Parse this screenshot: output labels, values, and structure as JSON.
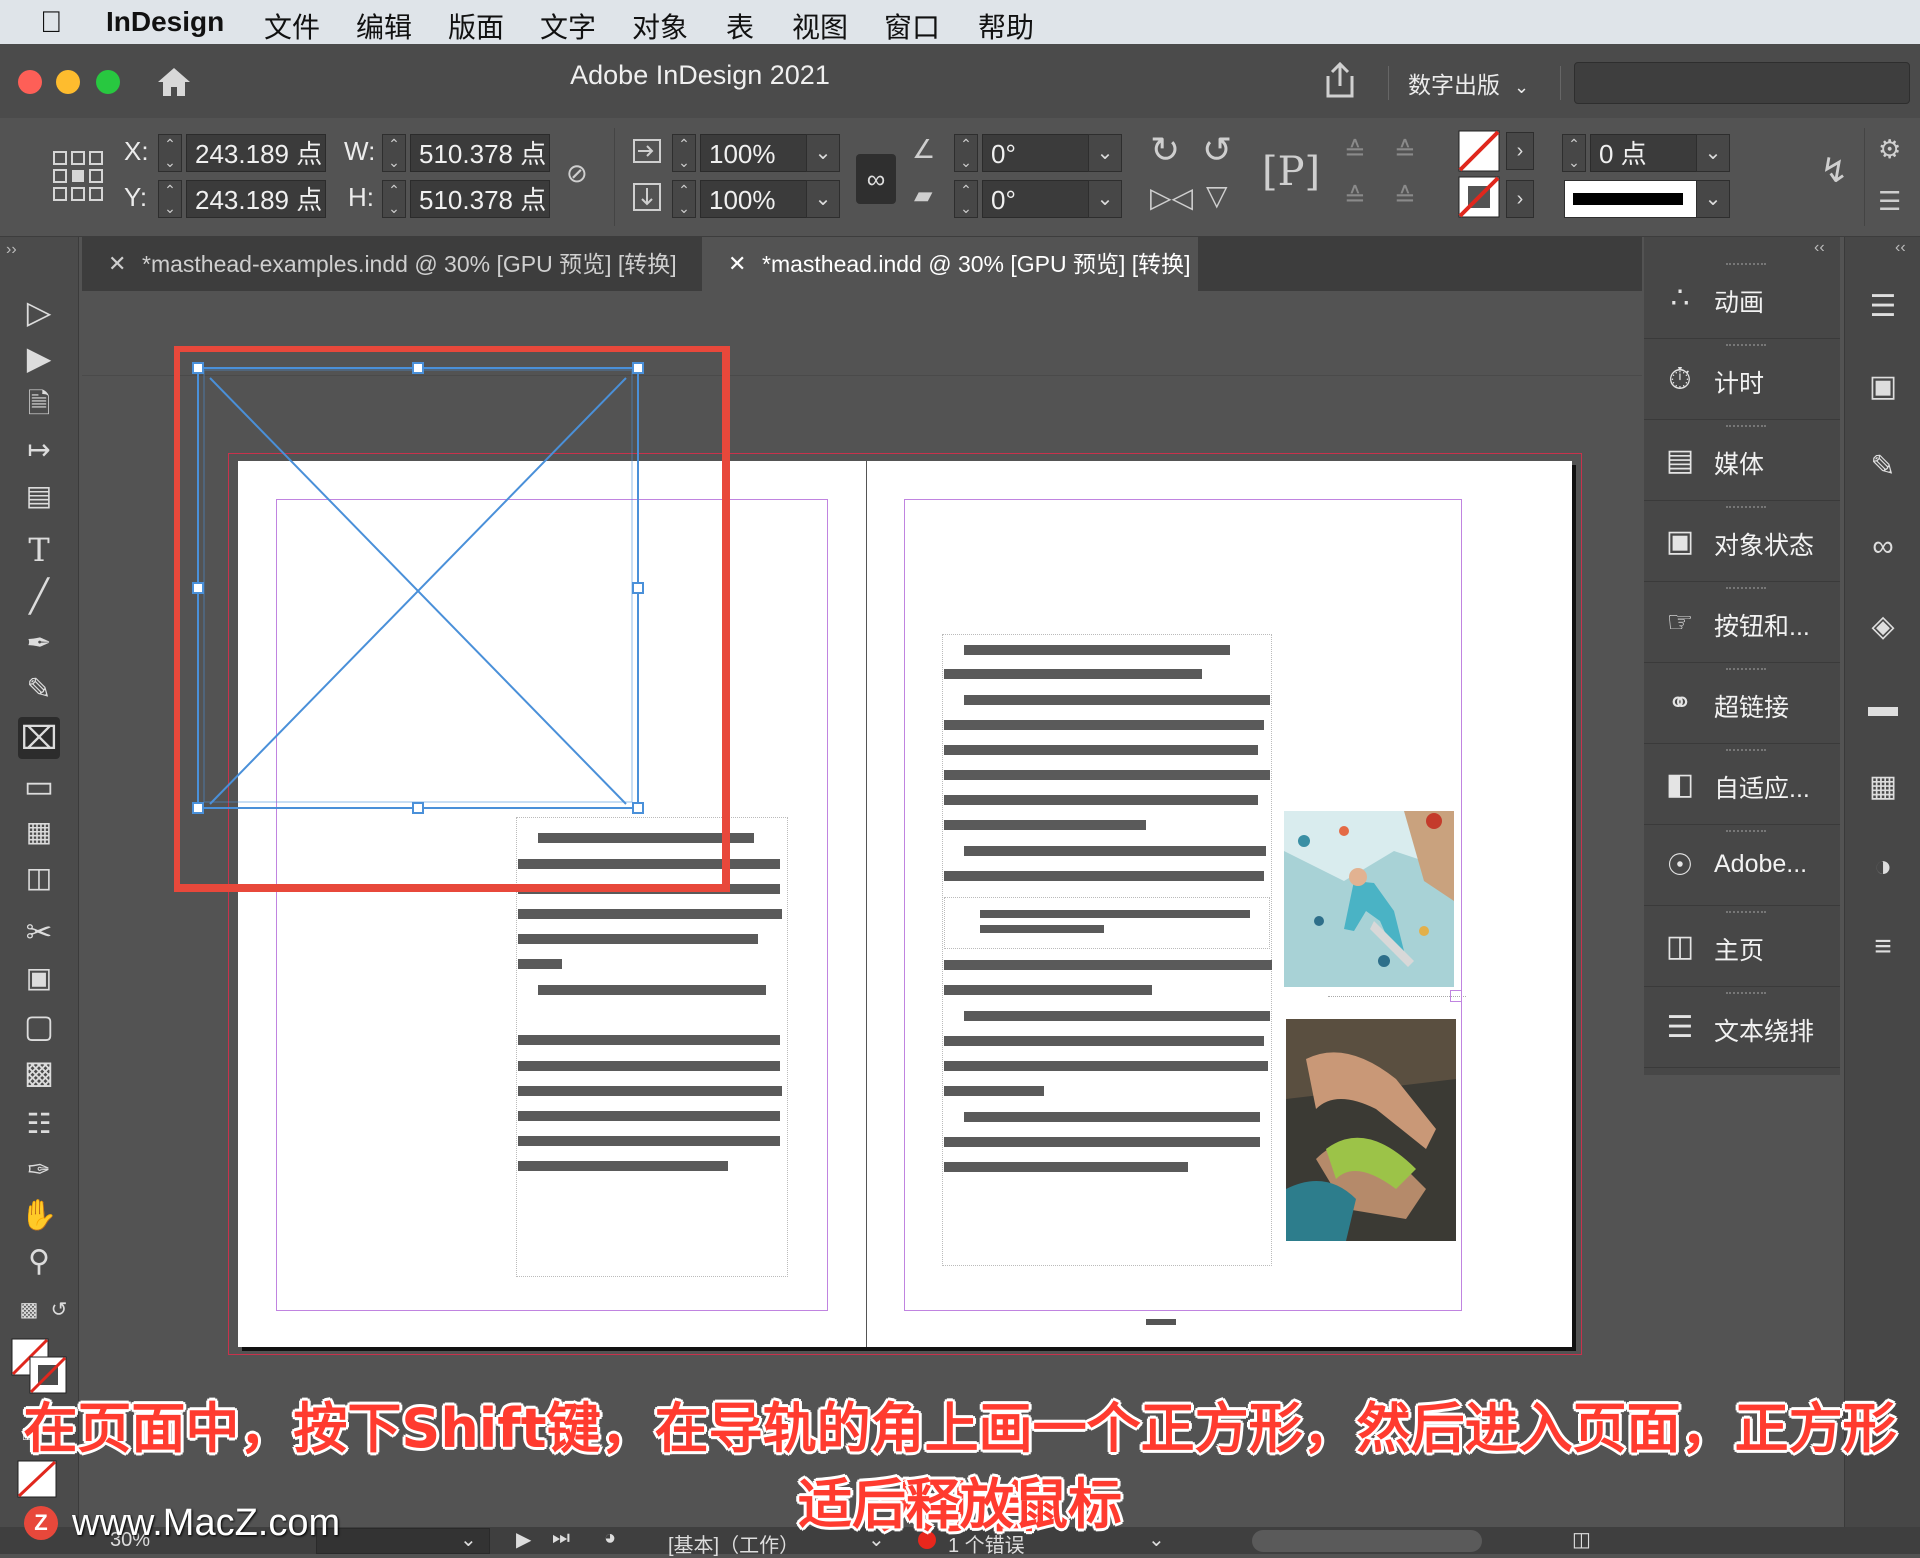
{
  "menubar": {
    "apple": "",
    "app": "InDesign",
    "items": [
      "文件",
      "编辑",
      "版面",
      "文字",
      "对象",
      "表",
      "视图",
      "窗口",
      "帮助"
    ]
  },
  "titlebar": {
    "title": "Adobe InDesign 2021",
    "workspace": "数字出版"
  },
  "control": {
    "x_label": "X:",
    "x_value": "243.189 点",
    "y_label": "Y:",
    "y_value": "243.189 点",
    "w_label": "W:",
    "w_value": "510.378 点",
    "h_label": "H:",
    "h_value": "510.378 点",
    "scale_x": "100%",
    "scale_y": "100%",
    "rotate": "0°",
    "shear": "0°",
    "stroke_weight": "0 点"
  },
  "tabs": [
    {
      "label": "*masthead-examples.indd @ 30% [GPU 预览] [转换]",
      "active": false
    },
    {
      "label": "*masthead.indd @ 30% [GPU 预览] [转换]",
      "active": true
    }
  ],
  "panels": [
    {
      "label": "动画",
      "icon": "animation-icon"
    },
    {
      "label": "计时",
      "icon": "timer-icon"
    },
    {
      "label": "媒体",
      "icon": "media-icon"
    },
    {
      "label": "对象状态",
      "icon": "object-states-icon"
    },
    {
      "label": "按钮和...",
      "icon": "buttons-icon"
    },
    {
      "label": "超链接",
      "icon": "hyperlinks-icon"
    },
    {
      "label": "自适应...",
      "icon": "liquid-layout-icon"
    },
    {
      "label": "Adobe...",
      "icon": "adobe-icon"
    },
    {
      "label": "主页",
      "icon": "pages-icon"
    },
    {
      "label": "文本绕排",
      "icon": "text-wrap-icon"
    }
  ],
  "status": {
    "zoom": "30%",
    "style": "[基本]（工作）",
    "errors": "1 个错误"
  },
  "caption": {
    "line1": "在页面中，按下Shift键，在导轨的角上画一个正方形，然后进入页面，正方形大小合",
    "line2": "适后释放鼠标"
  },
  "watermark": "www.MacZ.com",
  "colors": {
    "highlight": "#e8483b",
    "frame_blue": "#4a90d9",
    "margin_purple": "#b86ad6"
  }
}
